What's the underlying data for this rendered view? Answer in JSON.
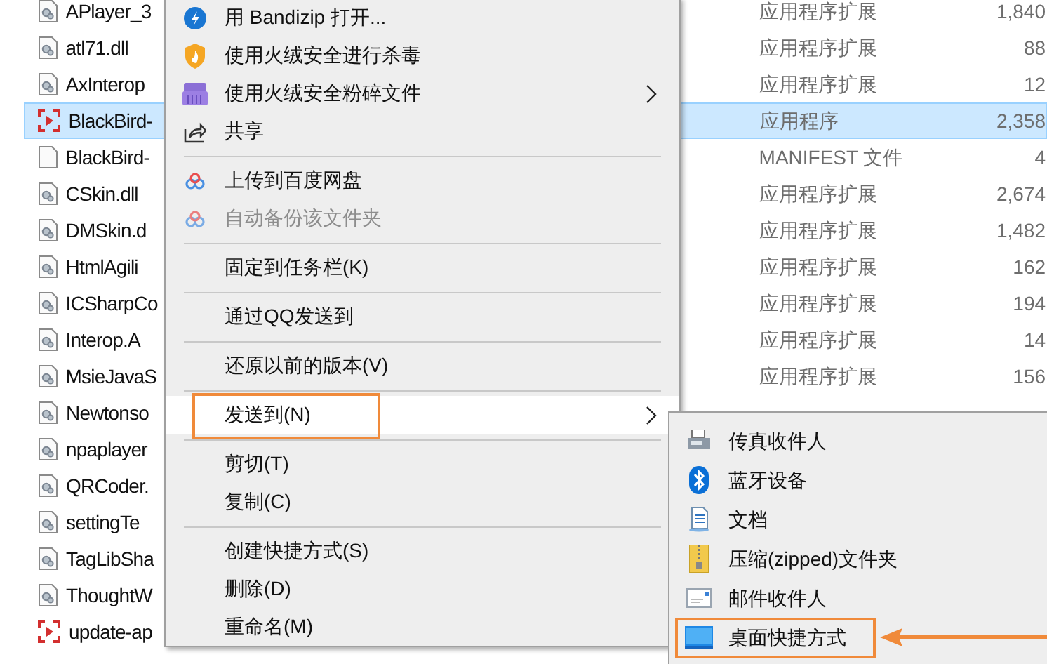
{
  "files": [
    {
      "name": "APlayer_3",
      "kind": "dll",
      "selected": false,
      "type": "应用程序扩展",
      "size": "1,840"
    },
    {
      "name": "atl71.dll",
      "kind": "dll",
      "selected": false,
      "type": "应用程序扩展",
      "size": "88"
    },
    {
      "name": "AxInterop",
      "kind": "dll",
      "selected": false,
      "type": "应用程序扩展",
      "size": "12"
    },
    {
      "name": "BlackBird-",
      "kind": "exe",
      "selected": true,
      "type": "应用程序",
      "size": "2,358"
    },
    {
      "name": "BlackBird-",
      "kind": "blank",
      "selected": false,
      "type": "MANIFEST 文件",
      "size": "4"
    },
    {
      "name": "CSkin.dll",
      "kind": "dll",
      "selected": false,
      "type": "应用程序扩展",
      "size": "2,674"
    },
    {
      "name": "DMSkin.d",
      "kind": "dll",
      "selected": false,
      "type": "应用程序扩展",
      "size": "1,482"
    },
    {
      "name": "HtmlAgili",
      "kind": "dll",
      "selected": false,
      "type": "应用程序扩展",
      "size": "162"
    },
    {
      "name": "ICSharpCo",
      "kind": "dll",
      "selected": false,
      "type": "应用程序扩展",
      "size": "194"
    },
    {
      "name": "Interop.A",
      "kind": "dll",
      "selected": false,
      "type": "应用程序扩展",
      "size": "14"
    },
    {
      "name": "MsieJavaS",
      "kind": "dll",
      "selected": false,
      "type": "应用程序扩展",
      "size": "156"
    },
    {
      "name": "Newtonso",
      "kind": "dll",
      "selected": false
    },
    {
      "name": "npaplayer",
      "kind": "dll",
      "selected": false
    },
    {
      "name": "QRCoder.",
      "kind": "dll",
      "selected": false
    },
    {
      "name": "settingTe",
      "kind": "dll",
      "selected": false
    },
    {
      "name": "TagLibSha",
      "kind": "dll",
      "selected": false
    },
    {
      "name": "ThoughtW",
      "kind": "dll",
      "selected": false
    },
    {
      "name": "update-ap",
      "kind": "exe",
      "selected": false
    }
  ],
  "context_menu": [
    {
      "kind": "item",
      "label": "用 Bandizip 打开...",
      "disabled": false,
      "submenu": false,
      "selected": false,
      "marked": false
    },
    {
      "kind": "item",
      "label": "使用火绒安全进行杀毒",
      "disabled": false,
      "submenu": false,
      "selected": false,
      "marked": false
    },
    {
      "kind": "item",
      "label": "使用火绒安全粉碎文件",
      "disabled": false,
      "submenu": true,
      "selected": false,
      "marked": false
    },
    {
      "kind": "item",
      "label": "共享",
      "disabled": false,
      "submenu": false,
      "selected": false,
      "marked": false
    },
    {
      "kind": "separator"
    },
    {
      "kind": "item",
      "label": "上传到百度网盘",
      "disabled": false,
      "submenu": false,
      "selected": false,
      "marked": false
    },
    {
      "kind": "item",
      "label": "自动备份该文件夹",
      "disabled": true,
      "submenu": false,
      "selected": false,
      "marked": false
    },
    {
      "kind": "separator"
    },
    {
      "kind": "item",
      "label": "固定到任务栏(K)",
      "disabled": false,
      "submenu": false,
      "selected": false,
      "marked": false
    },
    {
      "kind": "separator"
    },
    {
      "kind": "item",
      "label": "通过QQ发送到",
      "disabled": false,
      "submenu": false,
      "selected": false,
      "marked": false
    },
    {
      "kind": "separator"
    },
    {
      "kind": "item",
      "label": "还原以前的版本(V)",
      "disabled": false,
      "submenu": false,
      "selected": false,
      "marked": false
    },
    {
      "kind": "separator"
    },
    {
      "kind": "item",
      "label": "发送到(N)",
      "disabled": false,
      "submenu": true,
      "selected": true,
      "marked": true
    },
    {
      "kind": "separator"
    },
    {
      "kind": "item",
      "label": "剪切(T)",
      "disabled": false,
      "submenu": false,
      "selected": false,
      "marked": false
    },
    {
      "kind": "item",
      "label": "复制(C)",
      "disabled": false,
      "submenu": false,
      "selected": false,
      "marked": false
    },
    {
      "kind": "separator"
    },
    {
      "kind": "item",
      "label": "创建快捷方式(S)",
      "disabled": false,
      "submenu": false,
      "selected": false,
      "marked": false
    },
    {
      "kind": "item",
      "label": "删除(D)",
      "disabled": false,
      "submenu": false,
      "selected": false,
      "marked": false
    },
    {
      "kind": "item",
      "label": "重命名(M)",
      "disabled": false,
      "submenu": false,
      "selected": false,
      "marked": false
    }
  ],
  "send_to_menu": [
    {
      "label": "传真收件人",
      "marked": false
    },
    {
      "label": "蓝牙设备",
      "marked": false
    },
    {
      "label": "文档",
      "marked": false
    },
    {
      "label": "压缩(zipped)文件夹",
      "marked": false
    },
    {
      "label": "邮件收件人",
      "marked": false
    },
    {
      "label": "桌面快捷方式",
      "marked": true
    }
  ]
}
